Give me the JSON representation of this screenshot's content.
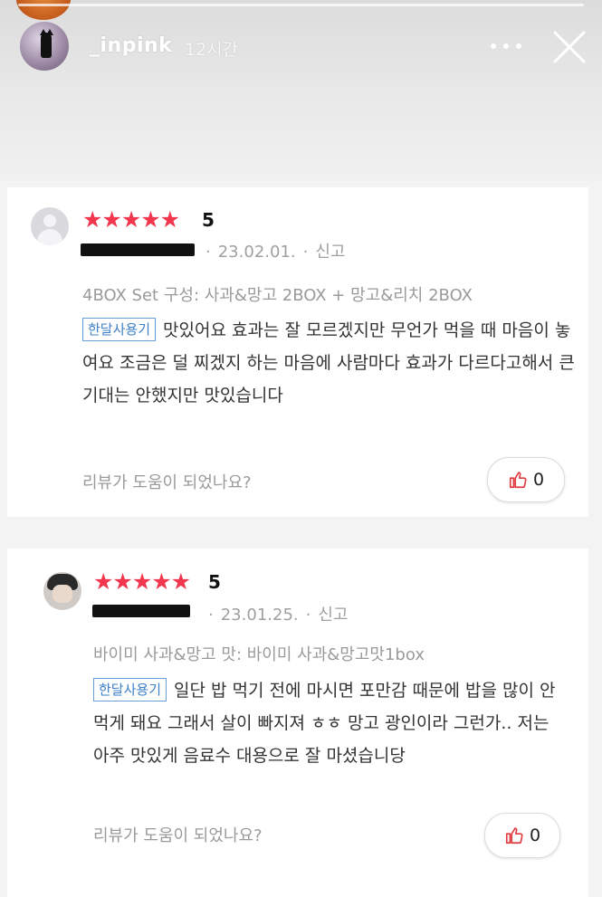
{
  "story": {
    "username": "_inpink",
    "time": "12시간",
    "more_icon": "more-horizontal-icon",
    "close_icon": "close-icon"
  },
  "reviews": [
    {
      "stars": "★★★★★",
      "rating": "5",
      "date": "23.02.01.",
      "report": "신고",
      "option": "4BOX Set 구성: 사과&망고 2BOX + 망고&리치 2BOX",
      "tag": "한달사용기",
      "text": "맛있어요 효과는 잘 모르겠지만 무언가 먹을 때 마음이 놓여요 조금은 덜 찌겠지 하는 마음에 사람마다 효과가 다르다고해서 큰 기대는 안했지만  맛있습니다",
      "helpful_prompt": "리뷰가 도움이 되었나요?",
      "like_count": "0"
    },
    {
      "stars": "★★★★★",
      "rating": "5",
      "date": "23.01.25.",
      "report": "신고",
      "option": "바이미 사과&망고 맛: 바이미 사과&망고맛1box",
      "tag": "한달사용기",
      "text": "일단 밥 먹기 전에 마시면 포만감 때문에 밥을 많이 안 먹게 돼요 그래서 살이 빠지져 ㅎㅎ 망고 광인이라 그런가.. 저는 아주 맛있게 음료수 대용으로 잘 마셨습니당",
      "helpful_prompt": "리뷰가 도움이 되었나요?",
      "like_count": "0"
    }
  ],
  "colors": {
    "star": "#f2364e",
    "tag_border": "#6aa0d8",
    "like_icon": "#e0393e"
  }
}
